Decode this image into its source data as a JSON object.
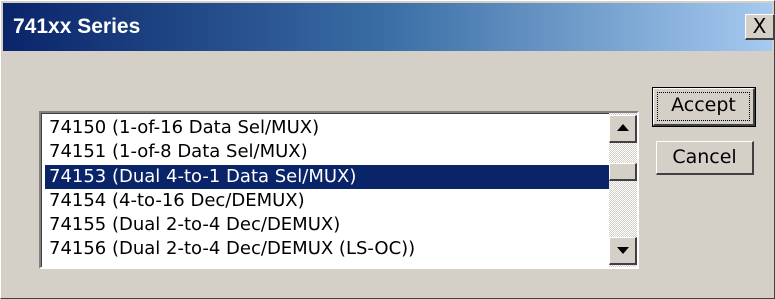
{
  "window": {
    "title": "741xx Series",
    "close_glyph": "X"
  },
  "list": {
    "items": [
      {
        "label": "74150 (1-of-16 Data Sel/MUX)"
      },
      {
        "label": "74151 (1-of-8 Data Sel/MUX)"
      },
      {
        "label": "74153 (Dual 4-to-1 Data Sel/MUX)",
        "selected": true
      },
      {
        "label": "74154 (4-to-16 Dec/DEMUX)"
      },
      {
        "label": "74155 (Dual 2-to-4 Dec/DEMUX)"
      },
      {
        "label": "74156 (Dual 2-to-4 Dec/DEMUX (LS-OC))"
      }
    ],
    "selected_index": 2
  },
  "buttons": {
    "accept_label": "Accept",
    "cancel_label": "Cancel"
  },
  "colors": {
    "title_gradient_start": "#0a246a",
    "title_gradient_end": "#a6caf0",
    "selection_bg": "#0a246a",
    "dialog_bg": "#d4d0c8"
  },
  "icons": {
    "close": "close-icon",
    "scroll_up": "scroll-up-arrow-icon",
    "scroll_down": "scroll-down-arrow-icon"
  }
}
